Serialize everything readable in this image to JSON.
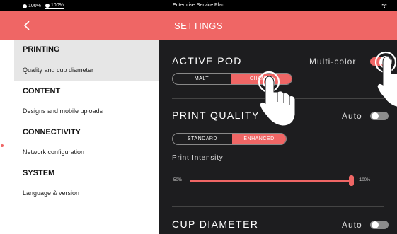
{
  "status_bar": {
    "battery_items": [
      "100%",
      "100%"
    ],
    "title": "Enterprise Service Plan",
    "icons": [
      "battery-icon",
      "wifi-icon"
    ]
  },
  "header": {
    "title": "SETTINGS",
    "back_icon": "chevron-left-icon"
  },
  "sidebar": {
    "sections": [
      {
        "title": "PRINTING",
        "item": "Quality and cup diameter"
      },
      {
        "title": "CONTENT",
        "item": "Designs and mobile uploads"
      },
      {
        "title": "CONNECTIVITY",
        "item": "Network configuration"
      },
      {
        "title": "SYSTEM",
        "item": "Language & version"
      }
    ]
  },
  "main": {
    "active_pod": {
      "title": "ACTIVE POD",
      "toggle_label": "Multi-color",
      "toggle_on": true,
      "options": [
        "MALT",
        "CHAMEL"
      ],
      "selected": "CHAMEL"
    },
    "print_quality": {
      "title": "PRINT QUALITY",
      "toggle_label": "Auto",
      "toggle_on": false,
      "options": [
        "STANDARD",
        "ENHANCED"
      ],
      "selected": "ENHANCED"
    },
    "print_intensity": {
      "label": "Print Intensity",
      "min_label": "50%",
      "max_label": "100%",
      "value_fraction": 1.0
    },
    "cup_diameter": {
      "title": "CUP DIAMETER",
      "toggle_label": "Auto",
      "toggle_on": false
    }
  },
  "colors": {
    "accent": "#ef6665",
    "panel": "#1d1d1f",
    "status_bar": "#000000"
  }
}
